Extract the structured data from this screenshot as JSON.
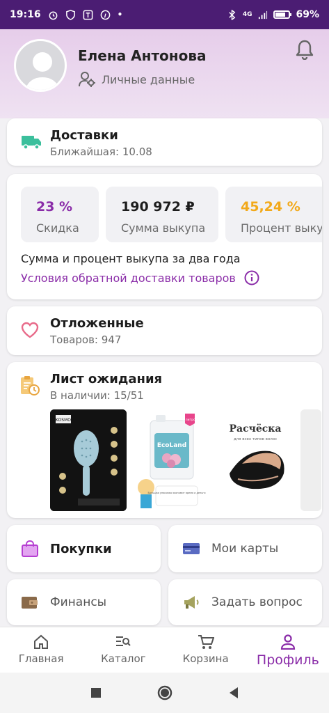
{
  "status_bar": {
    "time": "19:16",
    "network": "4G",
    "battery": "69%"
  },
  "colors": {
    "accent": "#8a2ca8",
    "status_bar": "#4b1d73",
    "discount": "#8a2ca8",
    "percent": "#f2a91a",
    "delivery_icon": "#3bbf9c",
    "heart": "#e86b8a"
  },
  "profile": {
    "name": "Елена Антонова",
    "personal_data_label": "Личные данные"
  },
  "delivery": {
    "title": "Доставки",
    "subtitle": "Ближайшая: 10.08"
  },
  "stats": {
    "items": [
      {
        "value": "23 %",
        "label": "Скидка"
      },
      {
        "value": "190 972 ₽",
        "label": "Сумма выкупа"
      },
      {
        "value": "45,24 %",
        "label": "Процент выкупа"
      }
    ],
    "note": "Сумма и процент выкупа за два года",
    "return_link": "Условия обратной доставки товаров"
  },
  "deferred": {
    "title": "Отложенные",
    "subtitle": "Товаров: 947"
  },
  "waitlist": {
    "title": "Лист ожидания",
    "subtitle": "В наличии: 15/51",
    "products": [
      {
        "brand": "KOSMO"
      },
      {
        "brand": "EcoLand",
        "badge": "5 литров",
        "tagline": "Большая упаковка экономит время и деньги"
      },
      {
        "title": "Расчёска",
        "subtitle": "для всех типов волос"
      }
    ]
  },
  "tiles": {
    "purchases": "Покупки",
    "cards": "Мои карты",
    "finance": "Финансы",
    "question": "Задать вопрос"
  },
  "nav": {
    "home": "Главная",
    "catalog": "Каталог",
    "cart": "Корзина",
    "profile": "Профиль"
  }
}
